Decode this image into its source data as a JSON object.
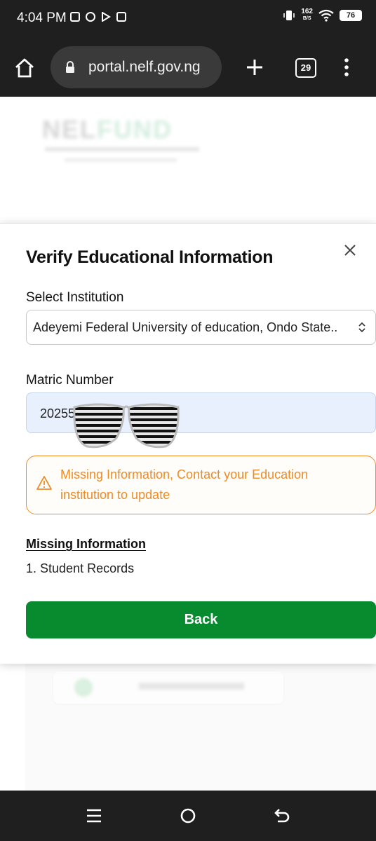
{
  "status_bar": {
    "time": "4:04 PM",
    "net_speed_value": "162",
    "net_speed_unit": "B/S",
    "battery": "76"
  },
  "browser": {
    "url": "portal.nelf.gov.ng",
    "tab_count": "29"
  },
  "modal": {
    "title": "Verify Educational Information",
    "institution_label": "Select Institution",
    "institution_value": "Adeyemi Federal University of education, Ondo State..",
    "matric_label": "Matric Number",
    "matric_value": "20255",
    "alert_message": "Missing Information, Contact your Education institution to update",
    "missing_title": "Missing Information",
    "missing_items": [
      "1. Student Records"
    ],
    "back_label": "Back"
  },
  "colors": {
    "primary_green": "#088a2f",
    "alert_orange": "#f08a24",
    "input_fill": "#e8f0fe"
  }
}
